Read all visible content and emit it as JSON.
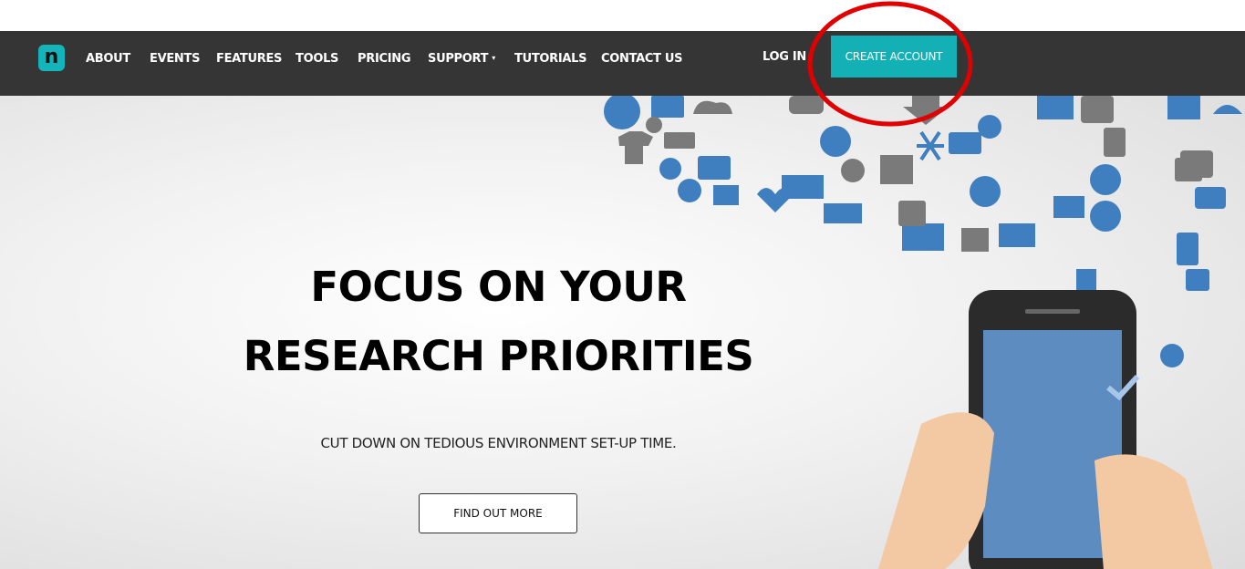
{
  "nav": {
    "logo_letter": "n",
    "items": [
      {
        "label": "ABOUT"
      },
      {
        "label": "EVENTS"
      },
      {
        "label": "FEATURES"
      },
      {
        "label": "TOOLS"
      },
      {
        "label": "PRICING"
      },
      {
        "label": "SUPPORT"
      },
      {
        "label": "TUTORIALS"
      },
      {
        "label": "CONTACT US"
      }
    ],
    "login_label": "LOG IN",
    "create_account_label": "CREATE ACCOUNT",
    "support_caret": "▾"
  },
  "hero": {
    "headline_line1": "FOCUS ON YOUR",
    "headline_line2": "RESEARCH PRIORITIES",
    "subtext": "CUT DOWN ON TEDIOUS ENVIRONMENT SET-UP TIME.",
    "cta_label": "FIND OUT MORE"
  },
  "colors": {
    "navbar_bg": "#353535",
    "accent_teal": "#13b0b5",
    "icon_blue": "#3f7fbf",
    "icon_gray": "#7a7a7a",
    "annotation_red": "#e00000"
  },
  "icons": [
    "clock-icon",
    "monitor-icon",
    "cloud-icon",
    "car-icon",
    "download-icon",
    "pictures-icon",
    "train-icon",
    "book-icon",
    "umbrella-icon",
    "gear-icon",
    "shirt-icon",
    "keyboard-icon",
    "paperclip-icon",
    "bicycle-icon",
    "eiffel-tower-icon",
    "headphones-icon",
    "people-icon",
    "snowflake-icon",
    "briefcase-icon",
    "disc-icon",
    "tv-icon",
    "fork-icon",
    "coffee-icon",
    "info-icon",
    "plane-icon",
    "lock-icon",
    "butterfly-icon",
    "globe-icon",
    "chart-icon",
    "heart-icon",
    "speakers-icon",
    "ship-icon",
    "rain-icon",
    "compass-icon",
    "mail-icon",
    "power-icon",
    "hospital-icon",
    "runner-icon",
    "upload-icon",
    "phone-icon",
    "music-icon",
    "check-icon"
  ]
}
